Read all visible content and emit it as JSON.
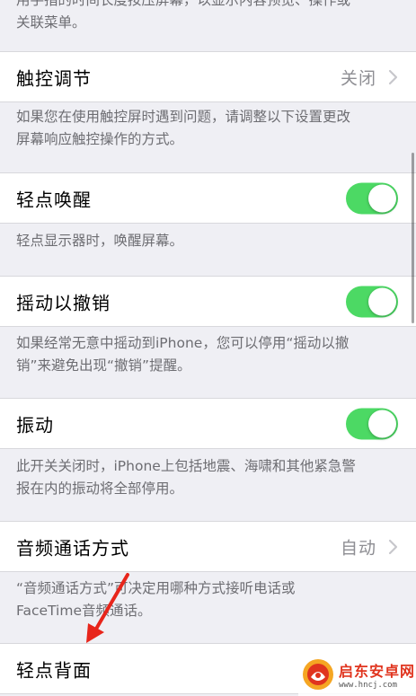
{
  "top_footer": {
    "line1": "用手指的时间长度按压屏幕，以显示内容预览、操作或",
    "line2": "关联菜单。"
  },
  "rows": [
    {
      "id": "touch-accommodations",
      "label": "触控调节",
      "value": "关闭",
      "control": "disclosure",
      "footer_lines": [
        "如果您在使用触控屏时遇到问题，请调整以下设置更改",
        "屏幕响应触控操作的方式。"
      ]
    },
    {
      "id": "tap-to-wake",
      "label": "轻点唤醒",
      "control": "toggle",
      "on": true,
      "footer_lines": [
        "轻点显示器时，唤醒屏幕。"
      ]
    },
    {
      "id": "shake-to-undo",
      "label": "摇动以撤销",
      "control": "toggle",
      "on": true,
      "footer_lines": [
        "如果经常无意中摇动到iPhone，您可以停用“摇动以撤",
        "销”来避免出现“撤销”提醒。"
      ]
    },
    {
      "id": "vibration",
      "label": "振动",
      "control": "toggle",
      "on": true,
      "footer_lines": [
        "此开关关闭时，iPhone上包括地震、海啸和其他紧急警",
        "报在内的振动将全部停用。"
      ]
    },
    {
      "id": "call-audio-routing",
      "label": "音频通话方式",
      "value": "自动",
      "control": "disclosure",
      "footer_lines": [
        "“音频通话方式”可决定用哪种方式接听电话或",
        "FaceTime音频通话。"
      ]
    },
    {
      "id": "back-tap",
      "label": "轻点背面",
      "control": "disclosure"
    }
  ],
  "watermark": {
    "name": "启东安卓网",
    "url": "www.hncj.com"
  },
  "colors": {
    "background": "#efeff4",
    "toggle_on": "#4cd964",
    "footer_text": "#6d6d72",
    "secondary_value": "#8e8e93",
    "arrow": "#e8251b"
  }
}
